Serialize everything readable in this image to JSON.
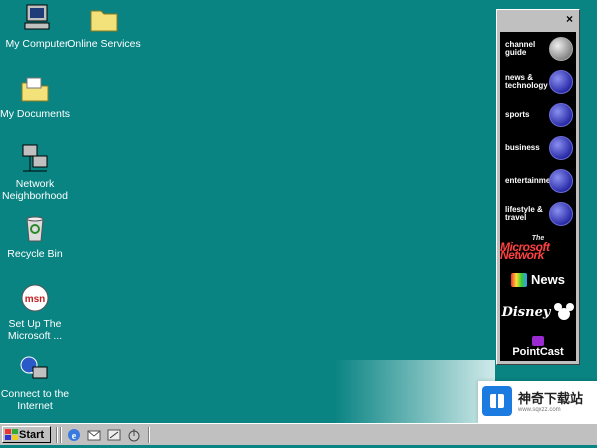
{
  "desktop": {
    "icons": [
      {
        "label": "My Computer",
        "icon": "computer-icon"
      },
      {
        "label": "Online Services",
        "icon": "folder-icon"
      },
      {
        "label": "My Documents",
        "icon": "documents-folder-icon"
      },
      {
        "label": "Network Neighborhood",
        "icon": "network-icon"
      },
      {
        "label": "Recycle Bin",
        "icon": "recycle-bin-icon"
      },
      {
        "label": "Set Up The Microsoft ...",
        "icon": "msn-icon"
      },
      {
        "label": "Connect to the Internet",
        "icon": "internet-connect-icon"
      }
    ]
  },
  "channel_bar": {
    "close_label": "×",
    "channels": [
      {
        "label": "channel guide"
      },
      {
        "label": "news & technology"
      },
      {
        "label": "sports"
      },
      {
        "label": "business"
      },
      {
        "label": "entertainment"
      },
      {
        "label": "lifestyle & travel"
      }
    ],
    "brands": {
      "msn_the": "The",
      "msn_name": "Microsoft Network",
      "msnbc": "News",
      "disney": "Disney",
      "pointcast": "PointCast"
    }
  },
  "taskbar": {
    "start_label": "Start",
    "quick_launch": [
      "ie-icon",
      "outlook-express-icon",
      "show-desktop-icon",
      "channels-icon"
    ]
  },
  "watermark": {
    "title": "神奇下载站",
    "url": "www.sqxzz.com"
  },
  "colors": {
    "desktop": "#0a8483",
    "taskbar": "#c0c0c0"
  }
}
